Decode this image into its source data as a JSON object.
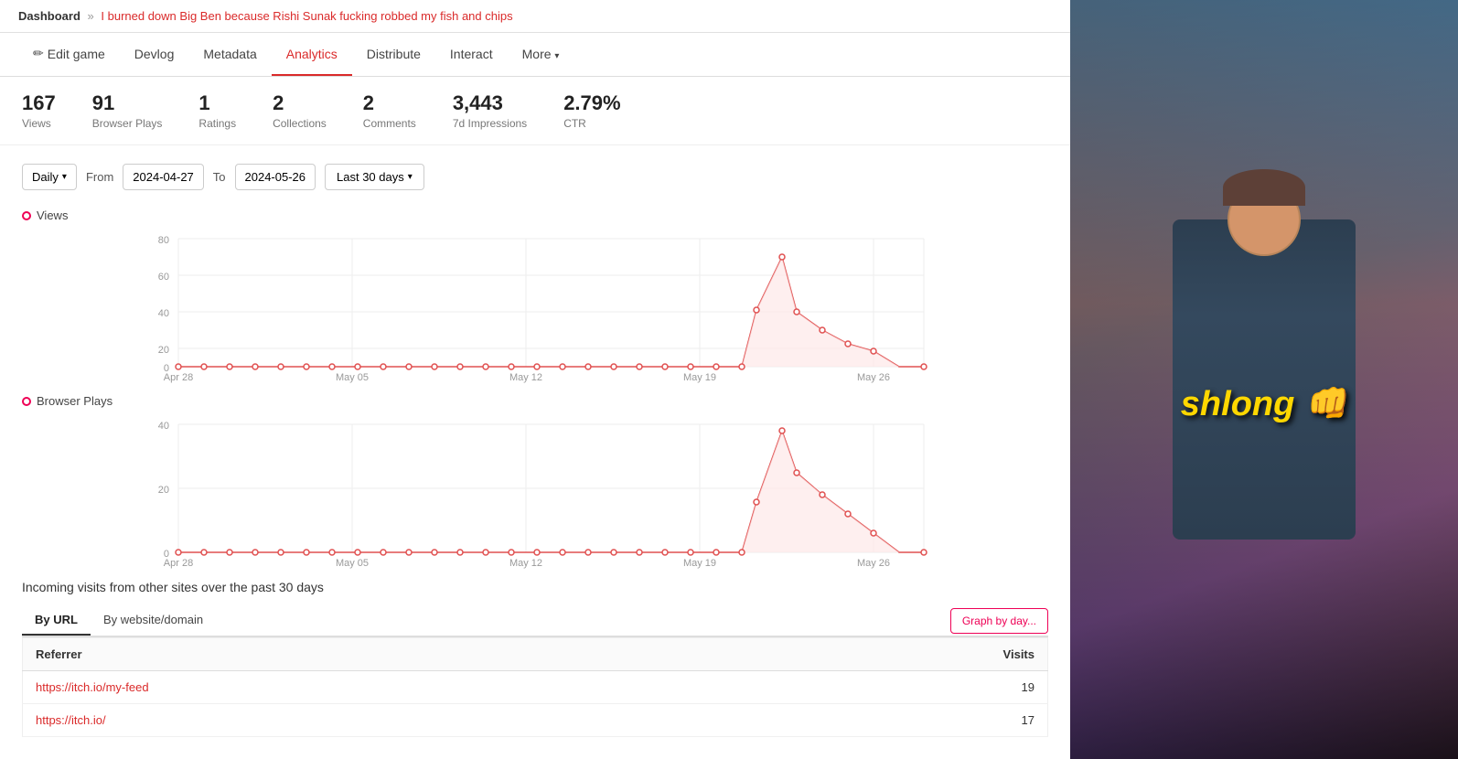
{
  "breadcrumb": {
    "dashboard": "Dashboard",
    "separator": "»",
    "game_title": "I burned down Big Ben because Rishi Sunak fucking robbed my fish and chips"
  },
  "tabs": [
    {
      "id": "edit-game",
      "label": "Edit game",
      "has_icon": true,
      "icon": "✏",
      "active": false
    },
    {
      "id": "devlog",
      "label": "Devlog",
      "active": false
    },
    {
      "id": "metadata",
      "label": "Metadata",
      "active": false
    },
    {
      "id": "analytics",
      "label": "Analytics",
      "active": true
    },
    {
      "id": "distribute",
      "label": "Distribute",
      "active": false
    },
    {
      "id": "interact",
      "label": "Interact",
      "active": false
    },
    {
      "id": "more",
      "label": "More",
      "has_dropdown": true,
      "active": false
    }
  ],
  "stats": [
    {
      "id": "views",
      "value": "167",
      "label": "Views"
    },
    {
      "id": "browser-plays",
      "value": "91",
      "label": "Browser Plays"
    },
    {
      "id": "ratings",
      "value": "1",
      "label": "Ratings"
    },
    {
      "id": "collections",
      "value": "2",
      "label": "Collections"
    },
    {
      "id": "comments",
      "value": "2",
      "label": "Comments"
    },
    {
      "id": "impressions",
      "value": "3,443",
      "label": "7d Impressions"
    },
    {
      "id": "ctr",
      "value": "2.79%",
      "label": "CTR"
    }
  ],
  "filters": {
    "granularity": "Daily",
    "from_label": "From",
    "from_date": "2024-04-27",
    "to_label": "To",
    "to_date": "2024-05-26",
    "range_label": "Last 30 days"
  },
  "charts": {
    "views": {
      "label": "Views",
      "color": "#e05050",
      "y_max": 80,
      "y_ticks": [
        0,
        20,
        40,
        60,
        80
      ],
      "x_labels": [
        "Apr 28",
        "May 05",
        "May 12",
        "May 19",
        "May 26"
      ],
      "peak_value": 65,
      "peak_label": "~65 around May 19-20"
    },
    "browser_plays": {
      "label": "Browser Plays",
      "color": "#e05050",
      "y_max": 40,
      "y_ticks": [
        0,
        20,
        40
      ],
      "x_labels": [
        "Apr 28",
        "May 05",
        "May 12",
        "May 19",
        "May 26"
      ],
      "peak_value": 38,
      "peak_label": "~38 around May 19-20"
    }
  },
  "incoming_visits": {
    "title": "Incoming visits from other sites over the past 30 days",
    "tabs": [
      {
        "id": "by-url",
        "label": "By URL",
        "active": true
      },
      {
        "id": "by-domain",
        "label": "By website/domain",
        "active": false
      }
    ],
    "graph_button": "Graph by day...",
    "table": {
      "headers": [
        "Referrer",
        "Visits"
      ],
      "rows": [
        {
          "url": "https://itch.io/my-feed",
          "visits": "19"
        },
        {
          "url": "https://itch.io/",
          "visits": "17"
        }
      ]
    }
  },
  "side_panel": {
    "overlay_text": "shlong 👊"
  }
}
